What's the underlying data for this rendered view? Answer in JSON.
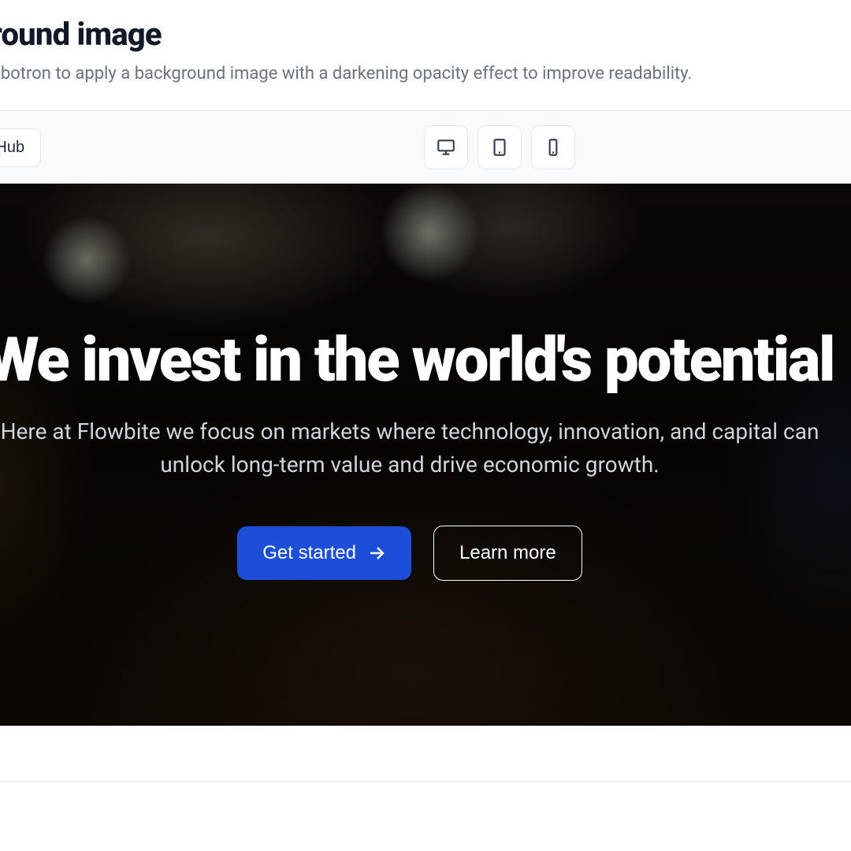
{
  "section": {
    "heading": "Background image",
    "description": "Use this jumbotron to apply a background image with a darkening opacity effect to improve readability."
  },
  "toolbar": {
    "github_label": "Edit on GitHub",
    "devices": {
      "desktop": "desktop",
      "tablet": "tablet",
      "mobile": "mobile"
    }
  },
  "hero": {
    "title": "We invest in the world's potential",
    "subtitle": "Here at Flowbite we focus on markets where technology, innovation, and capital can unlock long-term value and drive economic growth.",
    "primary_cta": "Get started",
    "secondary_cta": "Learn more"
  }
}
